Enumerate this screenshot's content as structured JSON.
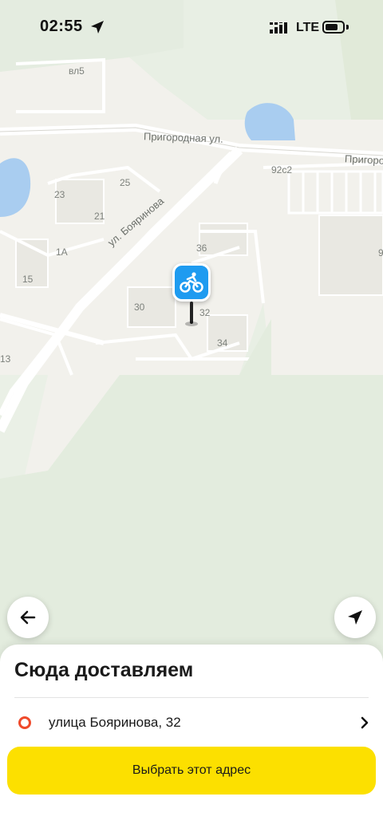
{
  "status_bar": {
    "time": "02:55",
    "network": "LTE",
    "battery_level": 0.75
  },
  "map": {
    "street_labels": [
      "Пригородная ул.",
      "Пригородн",
      "ул. Бояринова"
    ],
    "building_labels": [
      "вл5",
      "92с2",
      "25",
      "23",
      "21",
      "1А",
      "15",
      "36",
      "30",
      "32",
      "34",
      "13",
      "9"
    ],
    "pin_icon": "bicycle-courier-icon"
  },
  "buttons": {
    "back_icon": "arrow-left-icon",
    "locate_icon": "navigation-arrow-icon"
  },
  "sheet": {
    "title": "Сюда доставляем",
    "address": "улица Бояринова, 32",
    "confirm_label": "Выбрать этот адрес"
  },
  "colors": {
    "accent_yellow": "#fce000",
    "pin_blue": "#1e9bf0",
    "marker_red": "#ef4a2b"
  }
}
